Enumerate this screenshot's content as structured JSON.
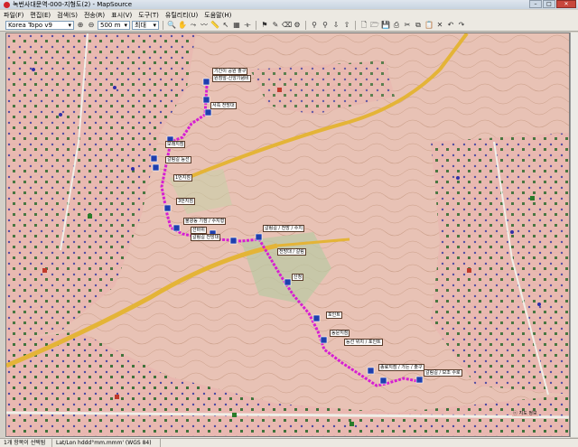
{
  "window": {
    "title": "녹번사대문역-000-지형도(2) - MapSource"
  },
  "menu": [
    "파일(F)",
    "편집(E)",
    "검색(S)",
    "전송(R)",
    "표시(V)",
    "도구(T)",
    "유틸리티(U)",
    "도움말(H)"
  ],
  "toolbar": {
    "map_product": "Korea Topo v9",
    "zoom_scale": "500 m",
    "detail_level": "최대"
  },
  "map": {
    "route_color": "#d61fd2",
    "road_color": "#e4b437",
    "labels": [
      "기간이 공원 출구",
      "원점앞-신앙기념비",
      "서쪽 전망대",
      "모래지점",
      "갈림길 능선",
      "1번지점",
      "3번지점",
      "불광동 기점 / 수지형",
      "선바위",
      "갈림길 전망대",
      "갈림길 / 전망 / 수지",
      "전망대 / 갈림",
      "산정",
      "포인트",
      "동문지점",
      "능선 위치 / 포인트",
      "종료지점 / 가든 / 출구",
      "갈림길 / 보조 수로"
    ],
    "watermark": "ⓒ 지도 정보"
  },
  "status": {
    "selection": "1개 항목이 선택됨",
    "coord_format": "Lat/Lon hddd°mm.mmm' (WGS 84)"
  }
}
